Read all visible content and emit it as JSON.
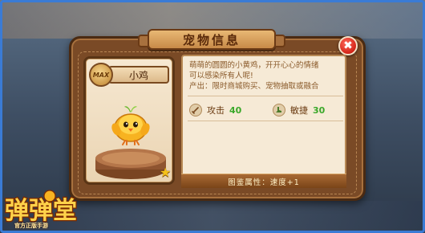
{
  "dialog": {
    "title": "宠物信息",
    "close_label": "✖"
  },
  "pet": {
    "name": "小鸡",
    "level_badge": "MAX",
    "star": "★"
  },
  "info": {
    "description_line1": "萌萌的圆圆的小黄鸡，开开心心的情绪",
    "description_line2": "可以感染所有人呢!",
    "source_line": "产出：限时商城购买、宠物抽取或融合",
    "stats": [
      {
        "label": "攻击",
        "value": "40",
        "icon": "sword-icon"
      },
      {
        "label": "敏捷",
        "value": "30",
        "icon": "boot-icon"
      }
    ],
    "atlas_attribute": "图鉴属性：速度+1"
  },
  "logo": {
    "title": "弹弹堂",
    "subtitle": "官方正版手游"
  },
  "colors": {
    "stat_value": "#3aa82a",
    "close_button": "#d32418",
    "dialog_wood": "#7a4a26"
  }
}
